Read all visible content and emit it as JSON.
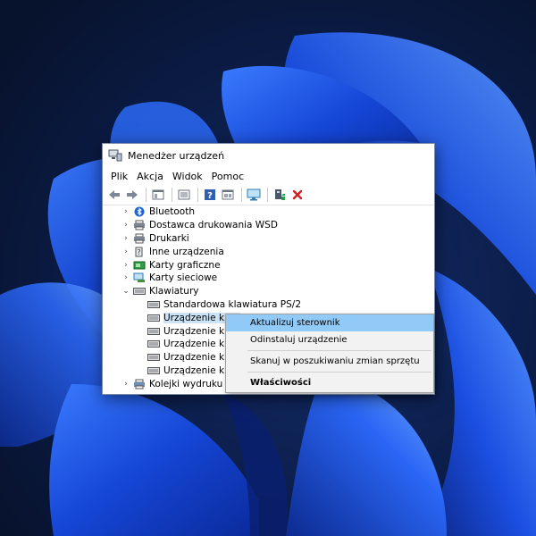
{
  "window": {
    "title": "Menedżer urządzeń",
    "menu": [
      "Plik",
      "Akcja",
      "Widok",
      "Pomoc"
    ]
  },
  "toolbar": {
    "icons": [
      "back-arrow-icon",
      "forward-arrow-icon",
      "show-hide-icon",
      "properties-icon",
      "help-icon",
      "view-icon",
      "monitor-icon",
      "add-driver-icon",
      "remove-icon"
    ]
  },
  "tree": {
    "items": [
      {
        "label": "Bluetooth",
        "icon": "bluetooth-icon"
      },
      {
        "label": "Dostawca drukowania WSD",
        "icon": "printer-icon"
      },
      {
        "label": "Drukarki",
        "icon": "printer-icon"
      },
      {
        "label": "Inne urządzenia",
        "icon": "unknown-device-icon"
      },
      {
        "label": "Karty graficzne",
        "icon": "display-adapter-icon"
      },
      {
        "label": "Karty sieciowe",
        "icon": "network-adapter-icon"
      },
      {
        "label": "Klawiatury",
        "icon": "keyboard-icon"
      },
      {
        "label": "Standardowa klawiatura PS/2",
        "icon": "keyboard-icon"
      },
      {
        "label": "Urządzenie klaw",
        "icon": "keyboard-icon"
      },
      {
        "label": "Urządzenie klaw",
        "icon": "keyboard-icon"
      },
      {
        "label": "Urządzenie klaw",
        "icon": "keyboard-icon"
      },
      {
        "label": "Urządzenie klaw",
        "icon": "keyboard-icon"
      },
      {
        "label": "Urządzenie klaw",
        "icon": "keyboard-icon"
      },
      {
        "label": "Kolejki wydruku",
        "icon": "print-queue-icon"
      }
    ]
  },
  "context_menu": {
    "update": "Aktualizuj sterownik",
    "uninstall": "Odinstaluj urządzenie",
    "scan": "Skanuj w poszukiwaniu zmian sprzętu",
    "properties": "Właściwości"
  },
  "colors": {
    "wallpaper_base": "#0a1a3a",
    "wallpaper_blue": "#1f4fe0",
    "highlight": "#91c9f7",
    "selection": "#cce4f7"
  }
}
